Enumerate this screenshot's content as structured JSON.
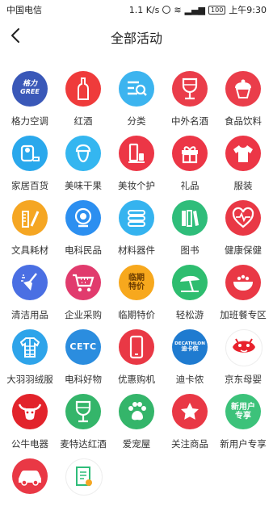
{
  "status": {
    "carrier": "中国电信",
    "speed": "1.1 K/s",
    "battery": "100",
    "time": "上午9:30"
  },
  "header": {
    "title": "全部活动"
  },
  "categories": [
    {
      "label": "格力空调",
      "color": "#3a58b8",
      "icon": "gree-logo-icon",
      "brand": "GREE"
    },
    {
      "label": "红酒",
      "color": "#ef3b3b",
      "icon": "wine-bottle-icon"
    },
    {
      "label": "分类",
      "color": "#3cb4ef",
      "icon": "category-list-icon"
    },
    {
      "label": "中外名酒",
      "color": "#ea3d4a",
      "icon": "wine-glass-icon"
    },
    {
      "label": "食品饮料",
      "color": "#ea3d4a",
      "icon": "cupcake-icon"
    },
    {
      "label": "家居百货",
      "color": "#2aa8ec",
      "icon": "tissue-roll-icon"
    },
    {
      "label": "美味干果",
      "color": "#34b6f0",
      "icon": "nut-icon"
    },
    {
      "label": "美妆个护",
      "color": "#ec3646",
      "icon": "cosmetics-icon"
    },
    {
      "label": "礼品",
      "color": "#ec3646",
      "icon": "gift-icon"
    },
    {
      "label": "服装",
      "color": "#ec3646",
      "icon": "tshirt-icon"
    },
    {
      "label": "文具耗材",
      "color": "#f5a623",
      "icon": "stationery-icon"
    },
    {
      "label": "电科民品",
      "color": "#2c8ff0",
      "icon": "webcam-icon"
    },
    {
      "label": "材料器件",
      "color": "#35b3ef",
      "icon": "materials-icon"
    },
    {
      "label": "图书",
      "color": "#2fbd7a",
      "icon": "books-icon"
    },
    {
      "label": "健康保健",
      "color": "#e93845",
      "icon": "heartbeat-icon"
    },
    {
      "label": "清洁用品",
      "color": "#4a6fe3",
      "icon": "broom-icon"
    },
    {
      "label": "企业采购",
      "color": "#e13b6d",
      "icon": "shopping-cart-icon"
    },
    {
      "label": "临期特价",
      "color": "#f7a81d",
      "icon": "discount-text-icon",
      "badge": "临期\n特价"
    },
    {
      "label": "轻松游",
      "color": "#2ebd6f",
      "icon": "beach-umbrella-icon"
    },
    {
      "label": "加班餐专区",
      "color": "#e93845",
      "icon": "food-bowl-icon"
    },
    {
      "label": "大羽羽绒服",
      "color": "#2ea4ea",
      "icon": "down-jacket-icon"
    },
    {
      "label": "电科好物",
      "color": "#2b8ddf",
      "icon": "cetc-logo-icon",
      "brand": "CETC"
    },
    {
      "label": "优惠购机",
      "color": "#e93845",
      "icon": "smartphone-icon"
    },
    {
      "label": "迪卡侬",
      "color": "#1f7bd0",
      "icon": "decathlon-logo-icon",
      "brand": "DECATHLON",
      "brand_sub": "迪卡侬"
    },
    {
      "label": "京东母婴",
      "color": "#ffffff",
      "icon": "jd-mascot-icon"
    },
    {
      "label": "公牛电器",
      "color": "#e2232b",
      "icon": "bull-logo-icon"
    },
    {
      "label": "麦特达红酒",
      "color": "#34b56a",
      "icon": "wine-glass-icon"
    },
    {
      "label": "爱宠屋",
      "color": "#34b56a",
      "icon": "paw-icon"
    },
    {
      "label": "关注商品",
      "color": "#e93845",
      "icon": "star-icon"
    },
    {
      "label": "新用户专享",
      "color": "#3cc27a",
      "icon": "new-user-text-icon",
      "badge": "新用户\n专享"
    },
    {
      "label": "",
      "color": "#e93845",
      "icon": "car-icon"
    },
    {
      "label": "",
      "color": "#ffffff",
      "icon": "document-certificate-icon"
    }
  ]
}
